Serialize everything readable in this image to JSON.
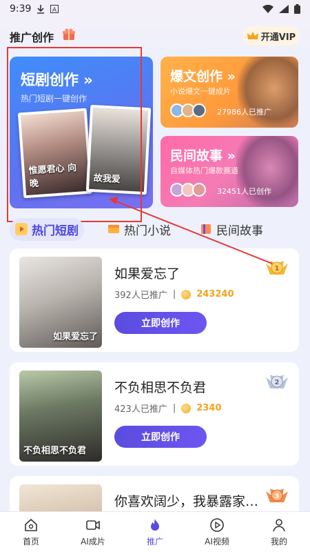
{
  "status": {
    "time": "9:39"
  },
  "header": {
    "title": "推广创作",
    "vip_label": "开通VIP"
  },
  "features": {
    "drama": {
      "title": "短剧创作 »",
      "subtitle": "热门短剧一键创作",
      "poster_a_caption": "惟愿君心 向晚",
      "poster_b_caption": "故我爱"
    },
    "article": {
      "title": "爆文创作 »",
      "subtitle": "小说爆文一键成片",
      "count": "27986人已推广"
    },
    "story": {
      "title": "民间故事 »",
      "subtitle": "自媒体热门爆款赛道",
      "count": "32451人已创作"
    }
  },
  "tabs": [
    {
      "label": "热门短剧",
      "icon": "play-icon"
    },
    {
      "label": "热门小说",
      "icon": "book-icon"
    },
    {
      "label": "民间故事",
      "icon": "scroll-icon"
    }
  ],
  "items": [
    {
      "title": "如果爱忘了",
      "promoted": "392人已推广",
      "sep": "|",
      "coins": "243240",
      "button": "立即创作",
      "rank": "1",
      "cover_caption": "如果爱忘了"
    },
    {
      "title": "不负相思不负君",
      "promoted": "423人已推广",
      "sep": "|",
      "coins": "2340",
      "button": "立即创作",
      "rank": "2",
      "cover_caption": "不负相思不负君"
    },
    {
      "title": "你喜欢阔少，我暴露家…",
      "rank": "3"
    }
  ],
  "nav": [
    {
      "label": "首页",
      "icon": "home-icon"
    },
    {
      "label": "AI成片",
      "icon": "video-icon"
    },
    {
      "label": "推广",
      "icon": "flame-icon"
    },
    {
      "label": "AI视频",
      "icon": "play-circle-icon"
    },
    {
      "label": "我的",
      "icon": "user-icon"
    }
  ],
  "colors": {
    "accent": "#5b4ce0",
    "annotation": "#e53935"
  }
}
